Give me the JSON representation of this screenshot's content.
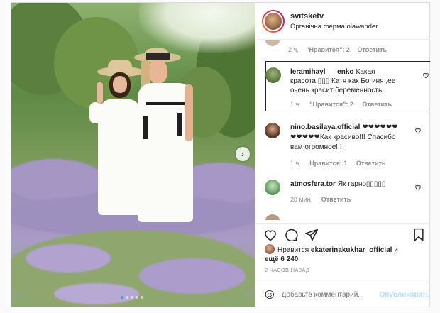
{
  "post": {
    "username": "svitsketv",
    "location": "Органічна ферма olawander",
    "next_arrow": "›"
  },
  "carousel": {
    "total": 5,
    "active_index": 0
  },
  "comments": {
    "prev_meta": {
      "time": "2 ч.",
      "likes": "\"Нравится\": 2",
      "reply": "Ответить"
    },
    "items": [
      {
        "user": "leramihayl___enko",
        "text": "Какая красота ▯▯▯ Катя как Богиня ,ее очень красит беременность",
        "time": "1 ч.",
        "likes": "\"Нравится\": 2",
        "reply": "Ответить"
      },
      {
        "user": "nino.basilaya.official",
        "text": "❤❤❤❤❤❤❤❤❤❤❤Как красиво!!! Спасибо вам огромное!!!",
        "time": "1 ч.",
        "likes": "Нравится: 1",
        "reply": "Ответить"
      },
      {
        "user": "atmosfera.tor",
        "text": "Як гарно▯▯▯▯▯",
        "time": "28 мин.",
        "likes": "",
        "reply": "Ответить"
      }
    ]
  },
  "likes": {
    "prefix": "Нравится",
    "user": "ekaterinakukhar_official",
    "connector": "и",
    "others": "ещё 6 240"
  },
  "time_ago": "2 ЧАСОВ НАЗАД",
  "add_comment": {
    "placeholder": "Добавьте комментарий...",
    "publish": "Опубликовать"
  },
  "colors": {
    "accent": "#3897f0",
    "publish_disabled": "#b2dffc",
    "meta": "#8e8e8e"
  }
}
